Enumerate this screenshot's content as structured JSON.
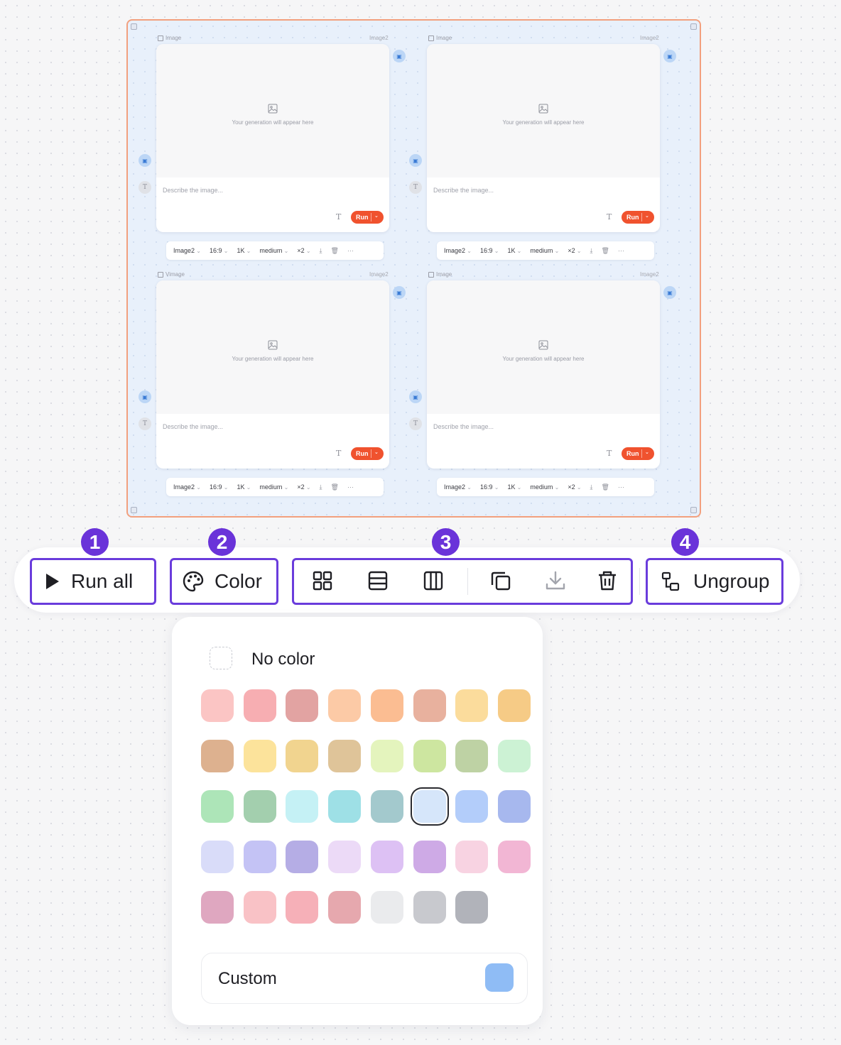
{
  "group": {
    "cards": [
      {
        "label": "Image",
        "model_tag": "Image2",
        "placeholder_text": "Your generation will appear here",
        "prompt_placeholder": "Describe the image...",
        "run_label": "Run",
        "toolbar": {
          "model": "Image2",
          "ratio": "16:9",
          "resolution": "1K",
          "quality": "medium",
          "count": "×2",
          "more": "···"
        }
      },
      {
        "label": "Image",
        "model_tag": "Image2",
        "placeholder_text": "Your generation will appear here",
        "prompt_placeholder": "Describe the image...",
        "run_label": "Run",
        "toolbar": {
          "model": "Image2",
          "ratio": "16:9",
          "resolution": "1K",
          "quality": "medium",
          "count": "×2",
          "more": "···"
        }
      },
      {
        "label": "Vimage",
        "model_tag": "Image2",
        "placeholder_text": "Your generation will appear here",
        "prompt_placeholder": "Describe the image...",
        "run_label": "Run",
        "toolbar": {
          "model": "Image2",
          "ratio": "16:9",
          "resolution": "1K",
          "quality": "medium",
          "count": "×2",
          "more": "···"
        }
      },
      {
        "label": "Image",
        "model_tag": "Image2",
        "placeholder_text": "Your generation will appear here",
        "prompt_placeholder": "Describe the image...",
        "run_label": "Run",
        "toolbar": {
          "model": "Image2",
          "ratio": "16:9",
          "resolution": "1K",
          "quality": "medium",
          "count": "×2",
          "more": "···"
        }
      }
    ],
    "border_color": "#f2a07e",
    "fill_color": "#e8f0fb"
  },
  "callouts": [
    "1",
    "2",
    "3",
    "4"
  ],
  "toolbar": {
    "run_all_label": "Run all",
    "color_label": "Color",
    "icons": [
      "grid-icon",
      "rows-icon",
      "columns-icon",
      "duplicate-icon",
      "download-icon",
      "trash-icon"
    ],
    "ungroup_label": "Ungroup",
    "highlight_color": "#6a3cdc"
  },
  "color_picker": {
    "no_color_label": "No color",
    "swatches": [
      "#fbc5c4",
      "#f7aeb2",
      "#e2a3a2",
      "#fccaa6",
      "#fbbd92",
      "#e8b19e",
      "#fbdc9c",
      "#f6cb86",
      "#ddb18f",
      "#fce39b",
      "#f1d48f",
      "#dfc499",
      "#e4f4bd",
      "#cde6a0",
      "#bed2a4",
      "#ccf2d4",
      "#ade5b8",
      "#a3cfae",
      "#c5f1f5",
      "#9ee0e6",
      "#a3c9cd",
      "#d6e6fa",
      "#b3cdfa",
      "#a7b8ee",
      "#d9dcf9",
      "#c4c3f5",
      "#b5ade5",
      "#ecdaf7",
      "#ddc1f4",
      "#ceaae6",
      "#f8d3e2",
      "#f2b6d4",
      "#dfa7c0",
      "#f9c2c6",
      "#f6b0b8",
      "#e6a8ae",
      "#eaebed",
      "#c8c9ce",
      "#b1b3ba"
    ],
    "selected_index": 21,
    "custom_label": "Custom",
    "custom_color": "#8fbcf5"
  }
}
